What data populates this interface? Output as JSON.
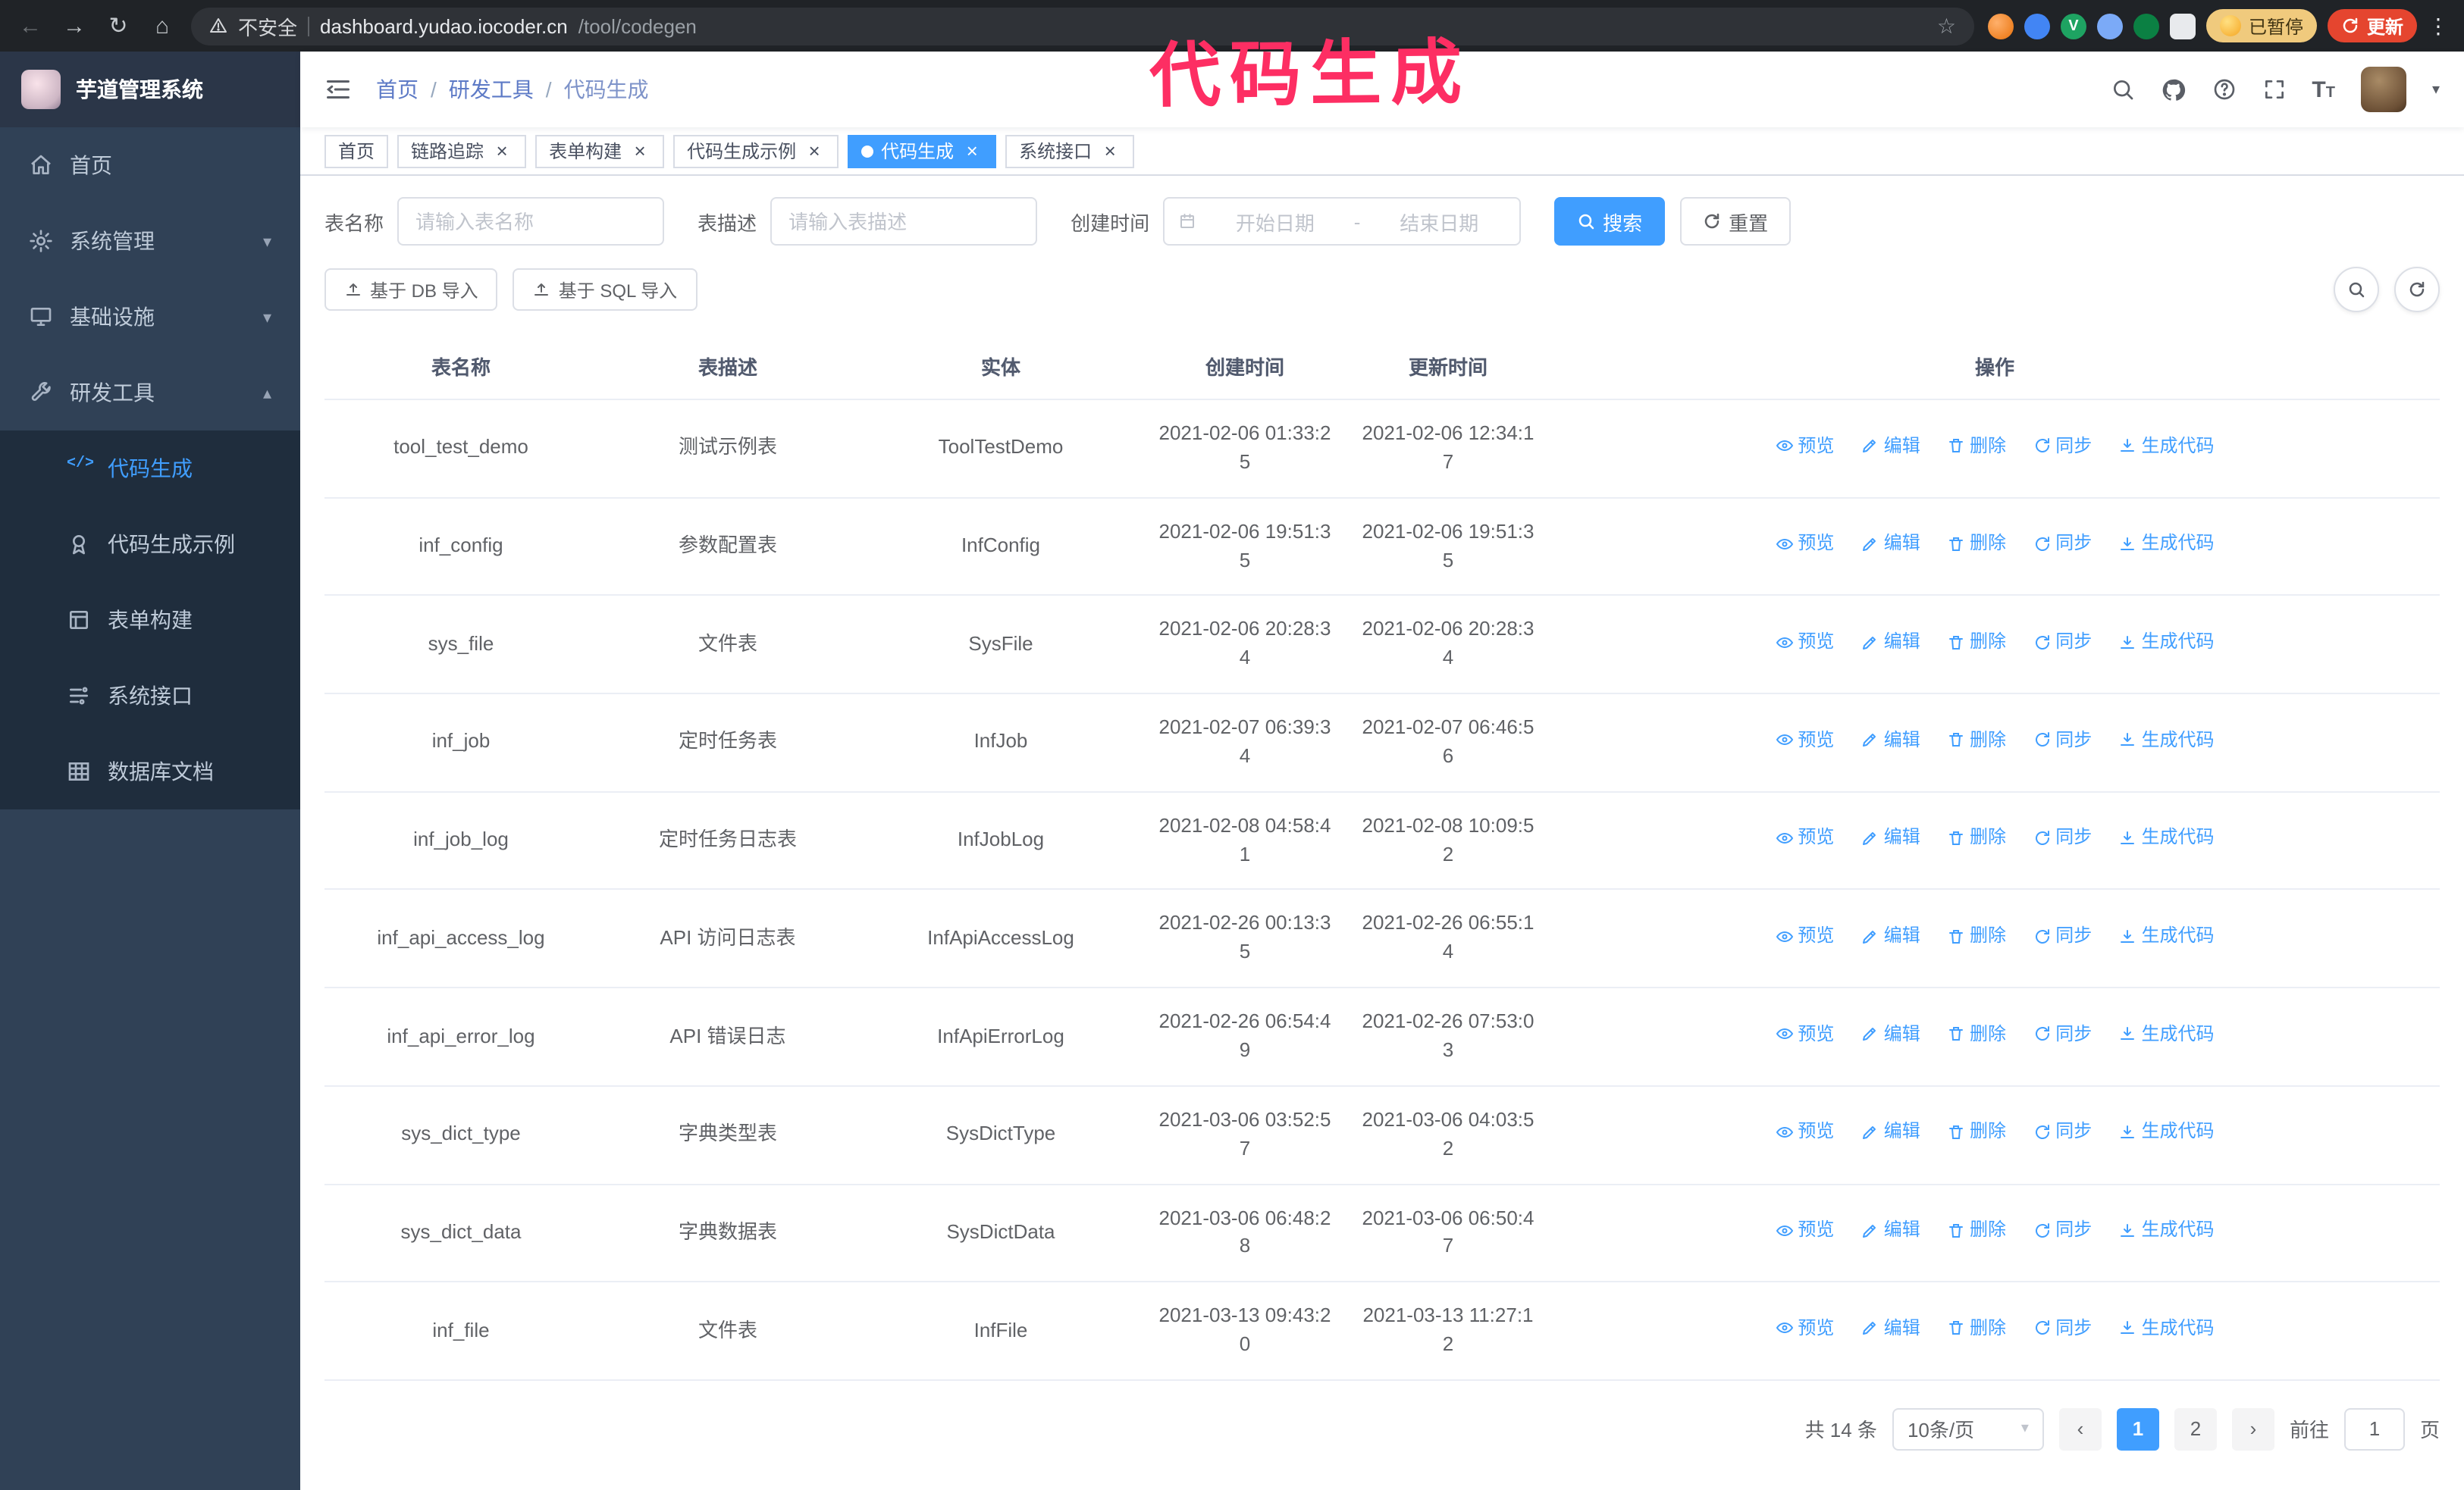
{
  "annotation": {
    "text": "代码生成"
  },
  "browser": {
    "security_label": "不安全",
    "url_host": "dashboard.yudao.iocoder.cn",
    "url_path": "/tool/codegen",
    "paused_badge": "已暂停",
    "update_button": "更新"
  },
  "sidebar": {
    "logo_title": "芋道管理系统",
    "items": [
      {
        "label": "首页"
      },
      {
        "label": "系统管理"
      },
      {
        "label": "基础设施"
      },
      {
        "label": "研发工具",
        "expanded": true
      }
    ],
    "subitems": [
      {
        "label": "代码生成",
        "active": true
      },
      {
        "label": "代码生成示例"
      },
      {
        "label": "表单构建"
      },
      {
        "label": "系统接口"
      },
      {
        "label": "数据库文档"
      }
    ]
  },
  "navbar": {
    "breadcrumb": [
      "首页",
      "研发工具",
      "代码生成"
    ]
  },
  "tabs": [
    {
      "label": "首页",
      "closable": false
    },
    {
      "label": "链路追踪"
    },
    {
      "label": "表单构建"
    },
    {
      "label": "代码生成示例"
    },
    {
      "label": "代码生成",
      "active": true
    },
    {
      "label": "系统接口"
    }
  ],
  "filters": {
    "table_name_label": "表名称",
    "table_name_placeholder": "请输入表名称",
    "table_desc_label": "表描述",
    "table_desc_placeholder": "请输入表描述",
    "create_time_label": "创建时间",
    "date_start_placeholder": "开始日期",
    "date_separator": "-",
    "date_end_placeholder": "结束日期",
    "search_button": "搜索",
    "reset_button": "重置"
  },
  "toolbar": {
    "import_db_button": "基于 DB 导入",
    "import_sql_button": "基于 SQL 导入"
  },
  "table": {
    "columns": [
      "表名称",
      "表描述",
      "实体",
      "创建时间",
      "更新时间",
      "操作"
    ],
    "actions": [
      "预览",
      "编辑",
      "删除",
      "同步",
      "生成代码"
    ],
    "rows": [
      {
        "name": "tool_test_demo",
        "desc": "测试示例表",
        "entity": "ToolTestDemo",
        "created": "2021-02-06 01:33:25",
        "updated": "2021-02-06 12:34:17"
      },
      {
        "name": "inf_config",
        "desc": "参数配置表",
        "entity": "InfConfig",
        "created": "2021-02-06 19:51:35",
        "updated": "2021-02-06 19:51:35"
      },
      {
        "name": "sys_file",
        "desc": "文件表",
        "entity": "SysFile",
        "created": "2021-02-06 20:28:34",
        "updated": "2021-02-06 20:28:34"
      },
      {
        "name": "inf_job",
        "desc": "定时任务表",
        "entity": "InfJob",
        "created": "2021-02-07 06:39:34",
        "updated": "2021-02-07 06:46:56"
      },
      {
        "name": "inf_job_log",
        "desc": "定时任务日志表",
        "entity": "InfJobLog",
        "created": "2021-02-08 04:58:41",
        "updated": "2021-02-08 10:09:52"
      },
      {
        "name": "inf_api_access_log",
        "desc": "API 访问日志表",
        "entity": "InfApiAccessLog",
        "created": "2021-02-26 00:13:35",
        "updated": "2021-02-26 06:55:14"
      },
      {
        "name": "inf_api_error_log",
        "desc": "API 错误日志",
        "entity": "InfApiErrorLog",
        "created": "2021-02-26 06:54:49",
        "updated": "2021-02-26 07:53:03"
      },
      {
        "name": "sys_dict_type",
        "desc": "字典类型表",
        "entity": "SysDictType",
        "created": "2021-03-06 03:52:57",
        "updated": "2021-03-06 04:03:52"
      },
      {
        "name": "sys_dict_data",
        "desc": "字典数据表",
        "entity": "SysDictData",
        "created": "2021-03-06 06:48:28",
        "updated": "2021-03-06 06:50:47"
      },
      {
        "name": "inf_file",
        "desc": "文件表",
        "entity": "InfFile",
        "created": "2021-03-13 09:43:20",
        "updated": "2021-03-13 11:27:12"
      }
    ]
  },
  "pagination": {
    "total_text": "共 14 条",
    "page_size": "10条/页",
    "pages": [
      {
        "label": "1",
        "active": true
      },
      {
        "label": "2"
      }
    ],
    "goto_prefix": "前往",
    "goto_value": "1",
    "goto_suffix": "页"
  },
  "icons": {
    "close": "×",
    "back_arrow": "←",
    "forward_arrow": "→",
    "reload": "↻",
    "home": "⌂",
    "star": "☆",
    "more_vertical": "⋮",
    "caret_down": "▾",
    "caret_up": "▴",
    "chevron_left": "‹",
    "chevron_right": "›",
    "breadcrumb_separator": "/",
    "code": "</>"
  },
  "colors": {
    "accent": "#409eff",
    "link": "#409eff",
    "tag_active": "#409eff",
    "annotation": "#fd2e63",
    "sidebar_bg": "#304156",
    "submenu_bg": "#1f2d3d",
    "browser_bar_bg": "#202327",
    "update_button_bg": "#e5452f",
    "paused_badge_bg": "#f0ca7d"
  }
}
